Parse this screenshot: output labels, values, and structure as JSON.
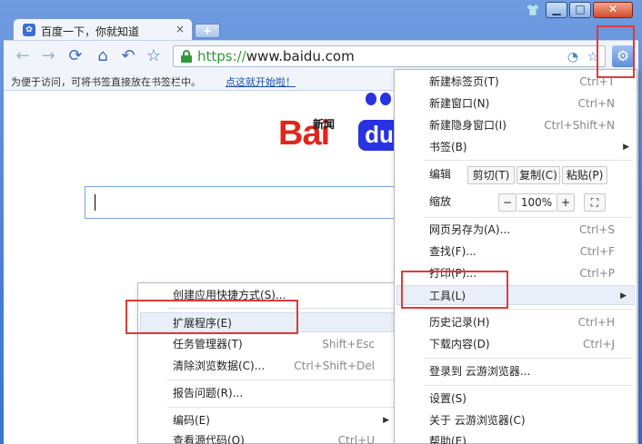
{
  "tab": {
    "title": "百度一下，你就知道",
    "close": "×",
    "favicon": "paw-icon"
  },
  "new_tab": "+",
  "window_controls": {
    "user": "👕",
    "minimize": "▁",
    "maximize": "□",
    "close": "✕"
  },
  "toolbar": {
    "back": "←",
    "forward": "→",
    "reload": "⟳",
    "home": "⌂",
    "undo": "↶",
    "star": "☆",
    "url_scheme": "https://",
    "url_host": "www.baidu.com",
    "settings": "⚙"
  },
  "bookmarks_bar": {
    "text": "为便于访问，可将书签直接放在书签栏中。",
    "link": "点这就开始啦！"
  },
  "page": {
    "news_link": "新闻",
    "logo_left": "Bai",
    "logo_right": "du"
  },
  "main_menu": {
    "items": [
      {
        "label": "新建标签页(T)",
        "shortcut": "Ctrl+T"
      },
      {
        "label": "新建窗口(N)",
        "shortcut": "Ctrl+N"
      },
      {
        "label": "新建隐身窗口(I)",
        "shortcut": "Ctrl+Shift+N"
      },
      {
        "label": "书签(B)",
        "shortcut": ""
      },
      {
        "label": "编辑",
        "shortcut": ""
      },
      {
        "label": "缩放",
        "shortcut": ""
      },
      {
        "label": "网页另存为(A)...",
        "shortcut": "Ctrl+S"
      },
      {
        "label": "查找(F)...",
        "shortcut": "Ctrl+F"
      },
      {
        "label": "打印(P)...",
        "shortcut": "Ctrl+P"
      },
      {
        "label": "工具(L)",
        "shortcut": ""
      },
      {
        "label": "历史记录(H)",
        "shortcut": "Ctrl+H"
      },
      {
        "label": "下载内容(D)",
        "shortcut": "Ctrl+J"
      },
      {
        "label": "登录到 云游浏览器...",
        "shortcut": ""
      },
      {
        "label": "设置(S)",
        "shortcut": ""
      },
      {
        "label": "关于 云游浏览器(C)",
        "shortcut": ""
      },
      {
        "label": "帮助(E)",
        "shortcut": ""
      }
    ],
    "edit": {
      "cut": "剪切(T)",
      "copy": "复制(C)",
      "paste": "粘贴(P)"
    },
    "zoom": {
      "minus": "−",
      "level": "100%",
      "plus": "+",
      "fullscreen": "⛶"
    },
    "submenu_arrow": "▶"
  },
  "tools_menu": {
    "items": [
      {
        "label": "创建应用快捷方式(S)...",
        "shortcut": ""
      },
      {
        "label": "扩展程序(E)",
        "shortcut": ""
      },
      {
        "label": "任务管理器(T)",
        "shortcut": "Shift+Esc"
      },
      {
        "label": "清除浏览数据(C)...",
        "shortcut": "Ctrl+Shift+Del"
      },
      {
        "label": "报告问题(R)...",
        "shortcut": ""
      },
      {
        "label": "编码(E)",
        "shortcut": ""
      },
      {
        "label": "查看源代码(O)",
        "shortcut": "Ctrl+U"
      }
    ]
  },
  "colors": {
    "highlight": "#e03a3a",
    "accent": "#3f6dbf",
    "logo_red": "#e1251b",
    "logo_blue": "#2932e1"
  }
}
